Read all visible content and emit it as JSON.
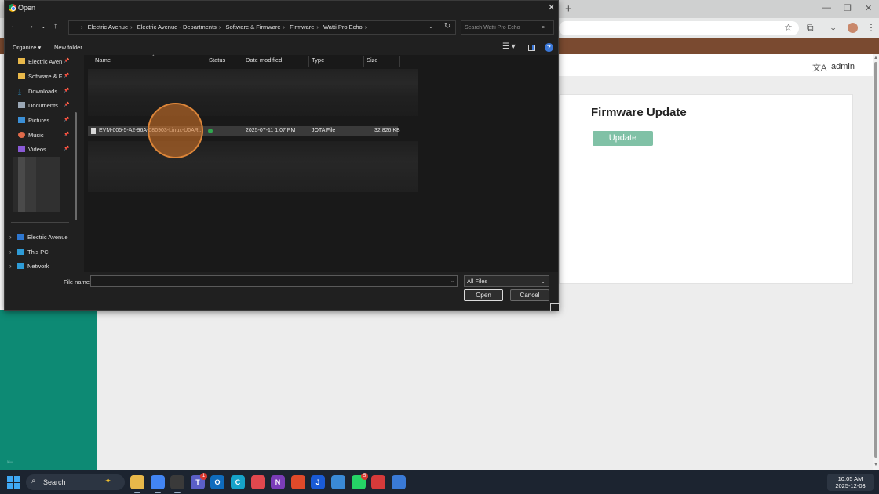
{
  "browser": {
    "window_controls": [
      "—",
      "❐",
      "✕"
    ],
    "header": {
      "username": "admin"
    },
    "firmware_card": {
      "title": "Firmware Update",
      "update_label": "Update"
    }
  },
  "dialog": {
    "title": "Open",
    "breadcrumb": [
      "Electric Avenue",
      "Electric Avenue - Departments",
      "Software & Firmware",
      "Firmware",
      "Watti Pro Echo"
    ],
    "search_placeholder": "Search Watti Pro Echo",
    "commands": {
      "organize": "Organize",
      "new_folder": "New folder"
    },
    "quick_access": [
      {
        "label": "Electric Aven",
        "icon": "folder-icon",
        "color": "#e8b84a"
      },
      {
        "label": "Software & F",
        "icon": "folder-icon",
        "color": "#e8b84a"
      },
      {
        "label": "Downloads",
        "icon": "download-icon",
        "color": "#2e9bd6"
      },
      {
        "label": "Documents",
        "icon": "documents-icon",
        "color": "#9aa7b5"
      },
      {
        "label": "Pictures",
        "icon": "pictures-icon",
        "color": "#3b8fd6"
      },
      {
        "label": "Music",
        "icon": "music-icon",
        "color": "#e06a4a"
      },
      {
        "label": "Videos",
        "icon": "videos-icon",
        "color": "#8a5ad6"
      }
    ],
    "tree": [
      {
        "label": "Electric Avenue",
        "icon": "onedrive-icon",
        "color": "#2e77d0"
      },
      {
        "label": "This PC",
        "icon": "pc-icon",
        "color": "#2e9bd6"
      },
      {
        "label": "Network",
        "icon": "network-icon",
        "color": "#2e9bd6"
      }
    ],
    "columns": {
      "name": "Name",
      "status": "Status",
      "date_modified": "Date modified",
      "type": "Type",
      "size": "Size"
    },
    "file": {
      "name": "EVM-005-5-A2-96A-080903-Linux-U0AR...",
      "status": "synced",
      "date_modified": "2025-07-11 1:07 PM",
      "type": "JOTA File",
      "size": "32,826 KB"
    },
    "file_name_label": "File name:",
    "file_name_value": "",
    "filter": "All Files",
    "buttons": {
      "open": "Open",
      "cancel": "Cancel"
    }
  },
  "taskbar": {
    "search_label": "Search",
    "apps": [
      {
        "name": "file-explorer-icon",
        "color": "#e8b84a",
        "glyph": ""
      },
      {
        "name": "chrome-icon",
        "color": "#4285f4",
        "glyph": ""
      },
      {
        "name": "chatgpt-icon",
        "color": "#3a3a3a",
        "glyph": ""
      },
      {
        "name": "teams-icon",
        "color": "#5b5fc7",
        "glyph": "T",
        "badge": "1"
      },
      {
        "name": "outlook-icon",
        "color": "#0f6cbd",
        "glyph": "O"
      },
      {
        "name": "canva-icon",
        "color": "#16a3c9",
        "glyph": "C"
      },
      {
        "name": "app-red-icon",
        "color": "#e0484e",
        "glyph": ""
      },
      {
        "name": "onenote-icon",
        "color": "#7a3cb8",
        "glyph": "N"
      },
      {
        "name": "app-swirl-icon",
        "color": "#e04a2a",
        "glyph": ""
      },
      {
        "name": "flash-icon",
        "color": "#1a5bd6",
        "glyph": "J"
      },
      {
        "name": "app-puzzle-icon",
        "color": "#3a8ad6",
        "glyph": ""
      },
      {
        "name": "whatsapp-icon",
        "color": "#25d366",
        "glyph": "",
        "badge": "5"
      },
      {
        "name": "app-cross-icon",
        "color": "#d63a3a",
        "glyph": ""
      },
      {
        "name": "app-compass-icon",
        "color": "#3a7ad6",
        "glyph": ""
      }
    ],
    "clock": {
      "time": "10:05 AM",
      "date": "2025-12-03"
    }
  }
}
